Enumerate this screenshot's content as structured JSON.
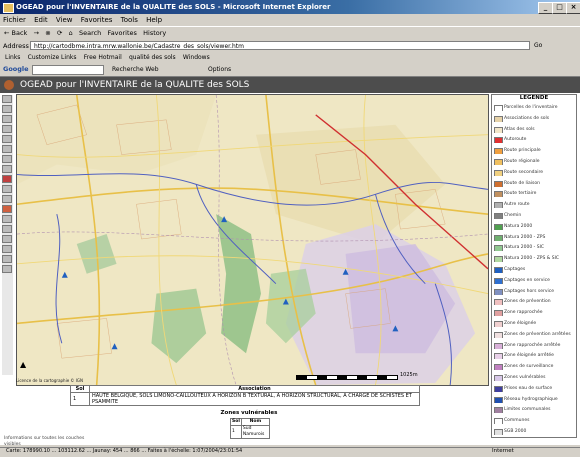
{
  "window": {
    "title": "OGEAD pour l'INVENTAIRE de la QUALITE des SOLS - Microsoft Internet Explorer",
    "min": "_",
    "max": "□",
    "close": "×"
  },
  "menu": [
    "Fichier",
    "Edit",
    "View",
    "Favorites",
    "Tools",
    "Help"
  ],
  "toolbar": [
    "← Back",
    "→",
    "⊗",
    "⟳",
    "⌂",
    "Search",
    "Favorites",
    "History"
  ],
  "address": {
    "label": "Address",
    "value": "http://cartodbme.intra.mrw.wallonie.be/Cadastre_des_sols/viewer.htm",
    "go": "Go"
  },
  "links": [
    "Links",
    "Customize Links",
    "Free Hotmail",
    "qualité des sols",
    "Windows"
  ],
  "google": {
    "label": "Google",
    "search": "Recherche Web",
    "options": "Options"
  },
  "app": {
    "title": "OGEAD pour l'INVENTAIRE de la QUALITE des SOLS"
  },
  "map": {
    "scale_label": "1025m",
    "copyright": "Licence de la cartographie © IGN"
  },
  "legend": {
    "title": "LEGENDE",
    "items": [
      {
        "label": "Parcelles de l'inventaire",
        "color": "#ffffff"
      },
      {
        "label": "Associations de sols",
        "color": "#e6d2a8"
      },
      {
        "label": "Atlas des sols",
        "color": "#f2e6c8"
      },
      {
        "label": "Autoroute",
        "color": "#e03030"
      },
      {
        "label": "Route principale",
        "color": "#f0a040"
      },
      {
        "label": "Route régionale",
        "color": "#f0c060"
      },
      {
        "label": "Route secondaire",
        "color": "#f0d080"
      },
      {
        "label": "Route de liaison",
        "color": "#d07030"
      },
      {
        "label": "Route tertiaire",
        "color": "#c09060"
      },
      {
        "label": "Autre route",
        "color": "#b0b0b0"
      },
      {
        "label": "Chemin",
        "color": "#808080"
      },
      {
        "label": "Natura 2000",
        "color": "#50a050"
      },
      {
        "label": "Natura 2000 - ZPS",
        "color": "#70b070"
      },
      {
        "label": "Natura 2000 - SIC",
        "color": "#90c890"
      },
      {
        "label": "Natura 2000 - ZPS & SIC",
        "color": "#b0d8a0"
      },
      {
        "label": "Captages",
        "color": "#2060c0"
      },
      {
        "label": "Captages en service",
        "color": "#3070d0"
      },
      {
        "label": "Captages hors service",
        "color": "#8090c0"
      },
      {
        "label": "Zones de prévention",
        "color": "#f0c0c0"
      },
      {
        "label": "Zone rapprochée",
        "color": "#e0a0a0"
      },
      {
        "label": "Zone éloignée",
        "color": "#f0d0d0"
      },
      {
        "label": "Zones de prévention arrêtées",
        "color": "#f0e0e0"
      },
      {
        "label": "Zone rapprochée arrêtée",
        "color": "#d8b0d8"
      },
      {
        "label": "Zone éloignée arrêtée",
        "color": "#e8d0e8"
      },
      {
        "label": "Zones de surveillance",
        "color": "#c080c0"
      },
      {
        "label": "Zones vulnérables",
        "color": "#d8c8e8"
      },
      {
        "label": "Prises eau de surface",
        "color": "#4040a0"
      },
      {
        "label": "Réseau hydrographique",
        "color": "#2050b0"
      },
      {
        "label": "Limites communales",
        "color": "#a080a0"
      },
      {
        "label": "Communes",
        "color": "#ffffff"
      },
      {
        "label": "SGB 2000",
        "color": "#e0e0e0"
      }
    ]
  },
  "results": {
    "headers": [
      "Sol",
      "Association"
    ],
    "rows": [
      [
        "1",
        "HAUTE BELGIQUE, SOLS LIMONO-CAILLOUTEUX A HORIZON B TEXTURAL, A HORIZON STRUCTURAL, A CHARGE DE SCHISTES ET PSAMMITE"
      ]
    ]
  },
  "zones_vulnerables": {
    "title": "Zones vulnérables",
    "headers": [
      "Sol",
      "Nom"
    ],
    "rows": [
      [
        "1",
        "Sud Namurois"
      ]
    ]
  },
  "info_text": "Informations sur toutes les couches visibles",
  "status": "Carte: 178990.10 ... 103112.62 ... Jaunay: 454 ... 866 ... Faites à l'échelle: 1:07/2004/23:01:54",
  "zone": "Internet"
}
